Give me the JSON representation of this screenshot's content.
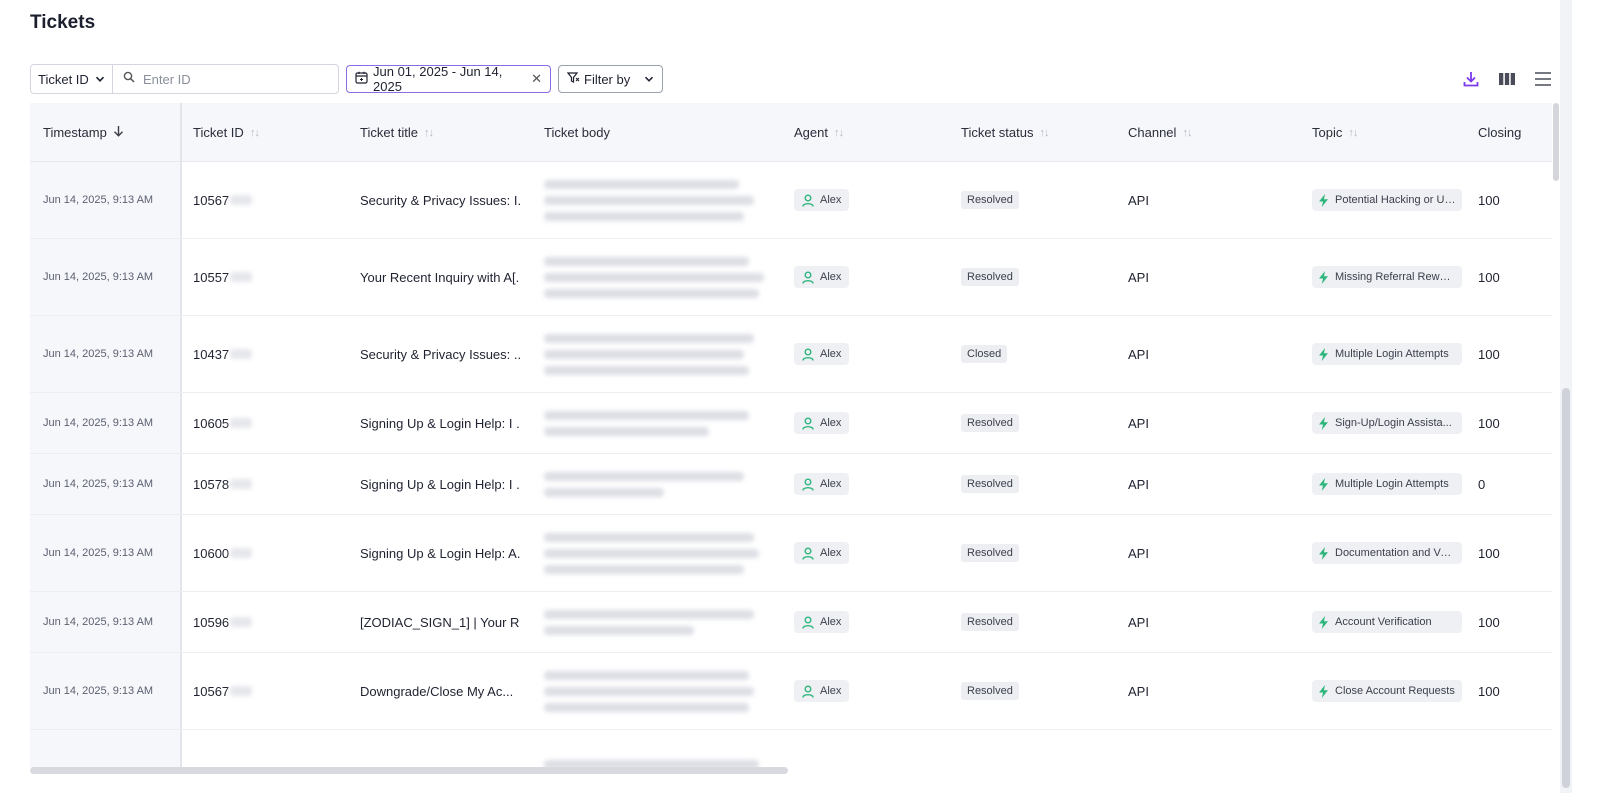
{
  "page": {
    "title": "Tickets"
  },
  "toolbar": {
    "id_selector": "Ticket ID",
    "search_placeholder": "Enter ID",
    "date_range": "Jun 01, 2025 - Jun 14, 2025",
    "filter_label": "Filter by"
  },
  "table": {
    "headers": {
      "timestamp": "Timestamp",
      "ticket_id": "Ticket ID",
      "ticket_title": "Ticket title",
      "ticket_body": "Ticket body",
      "agent": "Agent",
      "ticket_status": "Ticket status",
      "channel": "Channel",
      "topic": "Topic",
      "closing": "Closing"
    },
    "rows": [
      {
        "timestamp": "Jun 14, 2025, 9:13 AM",
        "id": "10567",
        "title": "Security & Privacy Issues: I...",
        "agent": "Alex",
        "status": "Resolved",
        "channel": "API",
        "topic": "Potential Hacking or Un...",
        "closing": "100"
      },
      {
        "timestamp": "Jun 14, 2025, 9:13 AM",
        "id": "10557",
        "title": "Your Recent Inquiry with A[...",
        "agent": "Alex",
        "status": "Resolved",
        "channel": "API",
        "topic": "Missing Referral Rewards",
        "closing": "100"
      },
      {
        "timestamp": "Jun 14, 2025, 9:13 AM",
        "id": "10437",
        "title": "Security & Privacy Issues: ...",
        "agent": "Alex",
        "status": "Closed",
        "channel": "API",
        "topic": "Multiple Login Attempts",
        "closing": "100"
      },
      {
        "timestamp": "Jun 14, 2025, 9:13 AM",
        "id": "10605",
        "title": "Signing Up & Login Help: I ...",
        "agent": "Alex",
        "status": "Resolved",
        "channel": "API",
        "topic": "Sign-Up/Login Assista...",
        "closing": "100"
      },
      {
        "timestamp": "Jun 14, 2025, 9:13 AM",
        "id": "10578",
        "title": "Signing Up & Login Help: I ...",
        "agent": "Alex",
        "status": "Resolved",
        "channel": "API",
        "topic": "Multiple Login Attempts",
        "closing": "0"
      },
      {
        "timestamp": "Jun 14, 2025, 9:13 AM",
        "id": "10600",
        "title": "Signing Up & Login Help: A...",
        "agent": "Alex",
        "status": "Resolved",
        "channel": "API",
        "topic": "Documentation and Ver...",
        "closing": "100"
      },
      {
        "timestamp": "Jun 14, 2025, 9:13 AM",
        "id": "10596",
        "title": "[ZODIAC_SIGN_1] | Your R...",
        "agent": "Alex",
        "status": "Resolved",
        "channel": "API",
        "topic": "Account Verification",
        "closing": "100"
      },
      {
        "timestamp": "Jun 14, 2025, 9:13 AM",
        "id": "10567",
        "title": "Downgrade/Close My Ac...",
        "agent": "Alex",
        "status": "Resolved",
        "channel": "API",
        "topic": "Close Account Requests",
        "closing": "100"
      }
    ]
  },
  "icons": {
    "search": "search-icon",
    "calendar": "calendar-icon",
    "clear": "close-icon",
    "filter": "filter-icon",
    "download": "download-icon",
    "columns": "columns-icon",
    "menu": "menu-icon",
    "agent": "user-icon",
    "topic": "bolt-icon"
  },
  "colors": {
    "accent": "#7c3aed",
    "agent_icon": "#2fb67c",
    "topic_icon": "#2fb67c"
  }
}
